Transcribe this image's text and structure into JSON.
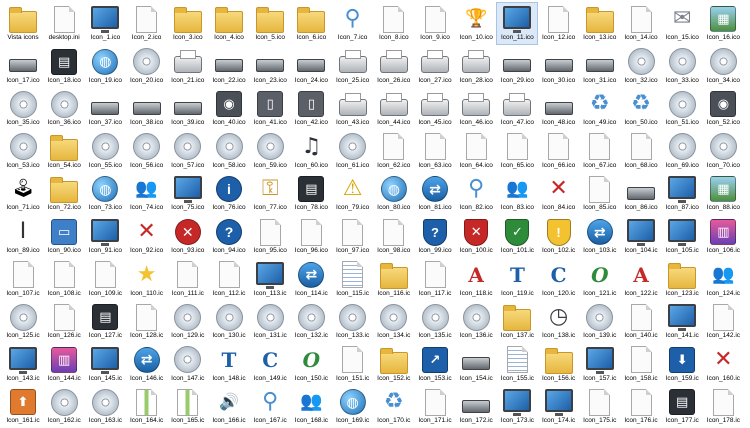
{
  "window": {
    "title": ""
  },
  "labels": [
    "Vista icons",
    "desktop.ini",
    "Icon_1.ico",
    "Icon_2.ico",
    "Icon_3.ico",
    "Icon_4.ico",
    "Icon_5.ico",
    "Icon_6.ico",
    "Icon_7.ico",
    "Icon_8.ico",
    "Icon_9.ico",
    "Icon_10.ico",
    "Icon_11.ico",
    "Icon_12.ico",
    "Icon_13.ico",
    "Icon_14.ico",
    "Icon_15.ico",
    "Icon_16.ico",
    "Icon_17.ico",
    "Icon_18.ico",
    "Icon_19.ico",
    "Icon_20.ico",
    "Icon_21.ico",
    "Icon_22.ico",
    "Icon_23.ico",
    "Icon_24.ico",
    "Icon_25.ico",
    "Icon_26.ico",
    "Icon_27.ico",
    "Icon_28.ico",
    "Icon_29.ico",
    "Icon_30.ico",
    "Icon_31.ico",
    "Icon_32.ico",
    "Icon_33.ico",
    "Icon_34.ico",
    "Icon_35.ico",
    "Icon_36.ico",
    "Icon_37.ico",
    "Icon_38.ico",
    "Icon_39.ico",
    "Icon_40.ico",
    "Icon_41.ico",
    "Icon_42.ico",
    "Icon_43.ico",
    "Icon_44.ico",
    "Icon_45.ico",
    "Icon_46.ico",
    "Icon_47.ico",
    "Icon_48.ico",
    "Icon_49.ico",
    "Icon_50.ico",
    "Icon_51.ico",
    "Icon_52.ico",
    "Icon_53.ico",
    "Icon_54.ico",
    "Icon_55.ico",
    "Icon_56.ico",
    "Icon_57.ico",
    "Icon_58.ico",
    "Icon_59.ico",
    "Icon_60.ico",
    "Icon_61.ico",
    "Icon_62.ico",
    "Icon_63.ico",
    "Icon_64.ico",
    "Icon_65.ico",
    "Icon_66.ico",
    "Icon_67.ico",
    "Icon_68.ico",
    "Icon_69.ico",
    "Icon_70.ico",
    "Icon_71.ico",
    "Icon_72.ico",
    "Icon_73.ico",
    "Icon_74.ico",
    "Icon_75.ico",
    "Icon_76.ico",
    "Icon_77.ico",
    "Icon_78.ico",
    "Icon_79.ico",
    "Icon_80.ico",
    "Icon_81.ico",
    "Icon_82.ico",
    "Icon_83.ico",
    "Icon_84.ico",
    "Icon_85.ico",
    "Icon_86.ico",
    "Icon_87.ico",
    "Icon_88.ico",
    "Icon_89.ico",
    "Icon_90.ico",
    "Icon_91.ico",
    "Icon_92.ico",
    "Icon_93.ico",
    "Icon_94.ico",
    "Icon_95.ico",
    "Icon_96.ico",
    "Icon_97.ico",
    "Icon_98.ico",
    "Icon_99.ico",
    "Icon_100.ic",
    "Icon_101.ic",
    "Icon_102.ic",
    "Icon_103.ic",
    "Icon_104.ic",
    "Icon_105.ic",
    "Icon_106.ic",
    "Icon_107.ic",
    "Icon_108.ic",
    "Icon_109.ic",
    "Icon_110.ic",
    "Icon_111.ic",
    "Icon_112.ic",
    "Icon_113.ic",
    "Icon_114.ic",
    "Icon_115.ic",
    "Icon_116.ic",
    "Icon_117.ic",
    "Icon_118.ic",
    "Icon_119.ic",
    "Icon_120.ic",
    "Icon_121.ic",
    "Icon_122.ic",
    "Icon_123.ic",
    "Icon_124.ic",
    "Icon_125.ic",
    "Icon_126.ic",
    "Icon_127.ic",
    "Icon_128.ic",
    "Icon_129.ic",
    "Icon_130.ic",
    "Icon_131.ic",
    "Icon_132.ic",
    "Icon_133.ic",
    "Icon_134.ic",
    "Icon_135.ic",
    "Icon_136.ic",
    "Icon_137.ic",
    "Icon_138.ic",
    "Icon_139.ic",
    "Icon_140.ic",
    "Icon_141.ic",
    "Icon_142.ic",
    "Icon_143.ic",
    "Icon_144.ic",
    "Icon_145.ic",
    "Icon_146.ic",
    "Icon_147.ic",
    "Icon_148.ic",
    "Icon_149.ic",
    "Icon_150.ic",
    "Icon_151.ic",
    "Icon_152.ic",
    "Icon_153.ic",
    "Icon_154.ic",
    "Icon_155.ic",
    "Icon_156.ic",
    "Icon_157.ic",
    "Icon_158.ic",
    "Icon_159.ic",
    "Icon_160.ic",
    "Icon_161.ic",
    "Icon_162.ic",
    "Icon_163.ic",
    "Icon_164.ic",
    "Icon_165.ic",
    "Icon_166.ic",
    "Icon_167.ic",
    "Icon_168.ic",
    "Icon_169.ic",
    "Icon_170.ic",
    "Icon_171.ic",
    "Icon_172.ic",
    "Icon_173.ic",
    "Icon_174.ic",
    "Icon_175.ic",
    "Icon_176.ic",
    "Icon_177.ic",
    "Icon_178.ic"
  ],
  "selected_item": "Icon_11.ico",
  "icon_kinds": [
    "folder",
    "doc",
    "monitor",
    "doc",
    "folder",
    "folder",
    "folder",
    "folder",
    "search-icon",
    "doc",
    "doc",
    "award",
    "window",
    "doc",
    "folder",
    "doc",
    "mail",
    "picture",
    "keyboard",
    "film",
    "globe",
    "disc",
    "printer",
    "drive",
    "drive",
    "drive",
    "printer",
    "printer-x",
    "printer",
    "printer",
    "drive",
    "drive",
    "drive",
    "dvd",
    "dvd",
    "dvd",
    "dvd",
    "dvd",
    "drive",
    "drive",
    "drive",
    "camcorder",
    "phone",
    "phone",
    "printer",
    "printer",
    "printer",
    "printer",
    "printer",
    "drive",
    "recycle",
    "recycle",
    "dvd",
    "camera",
    "disc",
    "folder",
    "mp3",
    "disc",
    "cd",
    "cd",
    "cd",
    "music",
    "disc",
    "doc",
    "doc",
    "doc",
    "doc",
    "doc",
    "doc",
    "doc",
    "disc",
    "disc",
    "joystick",
    "folder",
    "globe",
    "users",
    "window",
    "info",
    "key",
    "film",
    "warning",
    "globe",
    "network",
    "search-icon",
    "users",
    "close",
    "doc",
    "drive",
    "window",
    "picture",
    "font",
    "card",
    "tablet",
    "close",
    "error",
    "help",
    "doc",
    "doc",
    "doc",
    "doc",
    "shield",
    "shield-x",
    "shield-ok",
    "shield-warn",
    "network",
    "monitor",
    "monitor",
    "chart",
    "doc",
    "doc",
    "doc",
    "star",
    "doc",
    "doc",
    "monitor",
    "network",
    "list",
    "folder",
    "doc",
    "letter-a",
    "letter-t",
    "letter-c",
    "letter-o",
    "letter-a",
    "folder",
    "users",
    "mp3",
    "doc",
    "film",
    "doc",
    "dvd",
    "dvd",
    "dvd",
    "dvd",
    "dvd",
    "dvd",
    "dvd",
    "dvd",
    "folder",
    "clock",
    "disc",
    "doc",
    "monitor",
    "doc",
    "monitor",
    "chart",
    "monitor",
    "network",
    "disc",
    "letter-t",
    "letter-c",
    "letter-o",
    "doc",
    "folder",
    "shortcut",
    "drive",
    "list",
    "folder",
    "monitor-x",
    "doc",
    "download",
    "close",
    "upload",
    "dvd",
    "dvd",
    "zip",
    "zip",
    "speaker",
    "search-icon",
    "users",
    "globe",
    "recycle",
    "doc",
    "drive",
    "monitor",
    "monitor",
    "doc",
    "doc",
    "film",
    "doc"
  ],
  "colors": {
    "background": "#ffffff",
    "selection": "#dbe8f7",
    "folder": "#e6b63e",
    "blue": "#1d5fa8",
    "red": "#c62828",
    "green": "#2e8b3a",
    "yellow": "#f2c230"
  }
}
